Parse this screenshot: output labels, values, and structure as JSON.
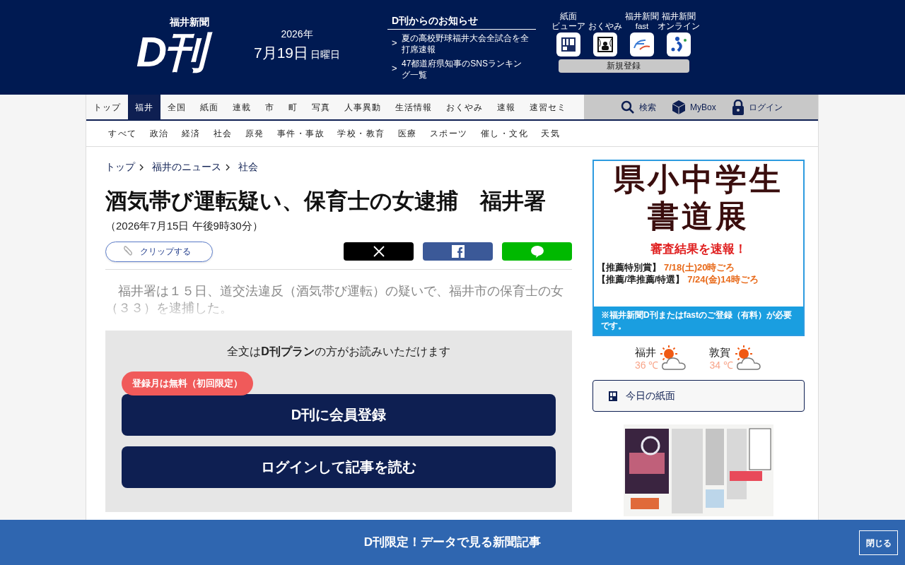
{
  "header": {
    "logo": {
      "small": "福井新聞",
      "main": "D刊"
    },
    "date": {
      "year": "2026年",
      "day": "7月19日",
      "weekday": "日曜日"
    },
    "notices": {
      "title": "D刊からのお知らせ",
      "items": [
        {
          "chevron": ">",
          "text": "夏の高校野球福井大会全試合を全打席速報"
        },
        {
          "chevron": ">",
          "text": "47都道府県知事のSNSランキング一覧"
        }
      ]
    },
    "apps": [
      {
        "kind": "viewer",
        "lines": [
          "紙面",
          "ビューア"
        ]
      },
      {
        "kind": "obituary",
        "lines": [
          "おくやみ"
        ]
      },
      {
        "kind": "fast",
        "lines": [
          "福井新聞",
          "fast"
        ]
      },
      {
        "kind": "online",
        "lines": [
          "福井新聞",
          "オンライン"
        ]
      }
    ],
    "register": "新規登録"
  },
  "nav": {
    "items": [
      {
        "label": "トップ",
        "selected": false
      },
      {
        "label": "福井",
        "selected": true
      },
      {
        "label": "全国",
        "selected": false
      },
      {
        "label": "紙面",
        "selected": false
      },
      {
        "label": "連載",
        "selected": false
      },
      {
        "label": "市",
        "selected": false
      },
      {
        "label": "町",
        "selected": false
      },
      {
        "label": "写真",
        "selected": false
      },
      {
        "label": "人事異動",
        "selected": false
      },
      {
        "label": "生活情報",
        "selected": false
      },
      {
        "label": "おくやみ",
        "selected": false
      },
      {
        "label": "速報",
        "selected": false
      },
      {
        "label": "速習セミ",
        "selected": false
      }
    ],
    "tools": [
      {
        "kind": "search",
        "label": "検索"
      },
      {
        "kind": "box",
        "label": "MyBox"
      },
      {
        "kind": "lock",
        "label": "ログイン"
      }
    ]
  },
  "subnav": [
    "すべて",
    "政治",
    "経済",
    "社会",
    "原発",
    "事件・事故",
    "学校・教育",
    "医療",
    "スポーツ",
    "催し・文化",
    "天気"
  ],
  "breadcrumb": [
    "トップ",
    "福井のニュース",
    "社会"
  ],
  "article": {
    "title": "酒気帯び運転疑い、保育士の女逮捕　福井署",
    "date": "（2026年7月15日 午後9時30分）",
    "clip": "クリップする",
    "share": [
      {
        "kind": "x"
      },
      {
        "kind": "facebook"
      },
      {
        "kind": "line"
      }
    ],
    "body": "　福井署は１５日、道交法違反（酒気帯び運転）の疑いで、福井市の保育士の女（３３）を逮捕した。"
  },
  "paywall": {
    "message": "全文は**D刊プラン**の方がお読みいただけます",
    "badge": "登録月は無料（初回限定）",
    "buttons": [
      "D刊に会員登録",
      "ログインして記事を読む"
    ]
  },
  "ad": {
    "title_lines": [
      "県小中学生",
      "書道展"
    ],
    "headline": "審査結果を**速報**！",
    "schedule": [
      {
        "label": "【推薦特別賞】",
        "when": "7/18(土)20時ごろ"
      },
      {
        "label": "【推薦/準推薦/特選】",
        "when": "7/24(金)14時ごろ"
      }
    ],
    "note": "※福井新聞D刊またはfastのご登録（有料）が必要です。"
  },
  "weather": [
    {
      "city": "福井",
      "temp": "36 ℃"
    },
    {
      "city": "敦賀",
      "temp": "34 ℃"
    }
  ],
  "paper_link": "今日の紙面",
  "bottom_banner": {
    "text": "D刊限定！データで見る新聞記事",
    "close": "閉じる"
  }
}
